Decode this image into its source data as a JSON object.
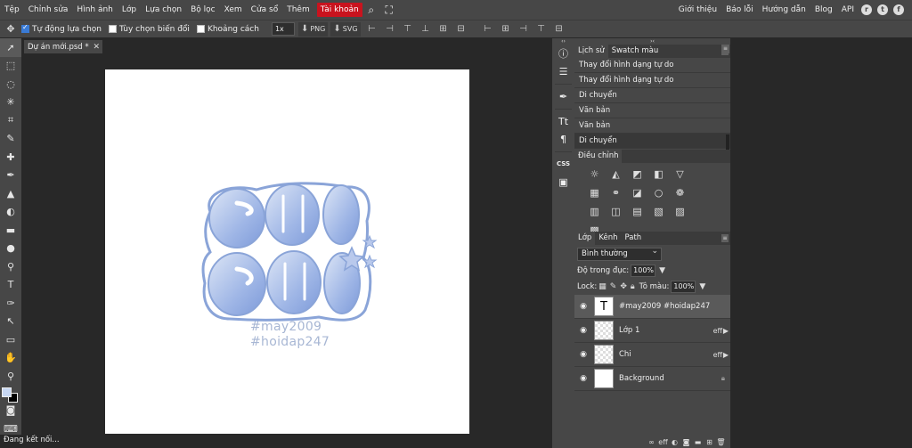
{
  "menu": {
    "items": [
      "Tệp",
      "Chỉnh sửa",
      "Hình ảnh",
      "Lớp",
      "Lựa chọn",
      "Bộ lọc",
      "Xem",
      "Cửa sổ",
      "Thêm"
    ],
    "account": "Tài khoản",
    "right_links": [
      "Giới thiệu",
      "Báo lỗi",
      "Hướng dẫn",
      "Blog",
      "API"
    ]
  },
  "options": {
    "auto_select": "Tự động lựa chọn",
    "transform_controls": "Tùy chọn biến đổi",
    "distances": "Khoảng cách",
    "zoom": "1x",
    "png": "PNG",
    "svg": "SVG"
  },
  "document": {
    "tab_title": "Dự án mới.psd *",
    "hashtag1": "#may2009",
    "hashtag2": "#hoidap247"
  },
  "status": "Đang kết nối...",
  "history": {
    "tab_history": "Lịch sử",
    "tab_swatches": "Swatch màu",
    "items": [
      "Thay đổi hình dạng tự do",
      "Thay đổi hình dạng tự do",
      "Di chuyển",
      "Văn bản",
      "Văn bản",
      "Di chuyển"
    ]
  },
  "adjustments": {
    "tab": "Điều chỉnh"
  },
  "layers": {
    "tab_layers": "Lớp",
    "tab_channels": "Kênh",
    "tab_paths": "Path",
    "blend_mode": "Bình thường",
    "opacity_label": "Độ trong đục:",
    "opacity_value": "100%",
    "lock_label": "Lock:",
    "fill_label": "Tô màu:",
    "fill_value": "100%",
    "items": [
      {
        "name": "#may2009 #hoidap247",
        "thumb": "T"
      },
      {
        "name": "Lớp 1",
        "fx": "eff"
      },
      {
        "name": "Chi",
        "fx": "eff"
      },
      {
        "name": "Background"
      }
    ]
  },
  "colors": {
    "foreground": "#c8d8f4",
    "background": "#000000",
    "account_red": "#c9131e"
  }
}
